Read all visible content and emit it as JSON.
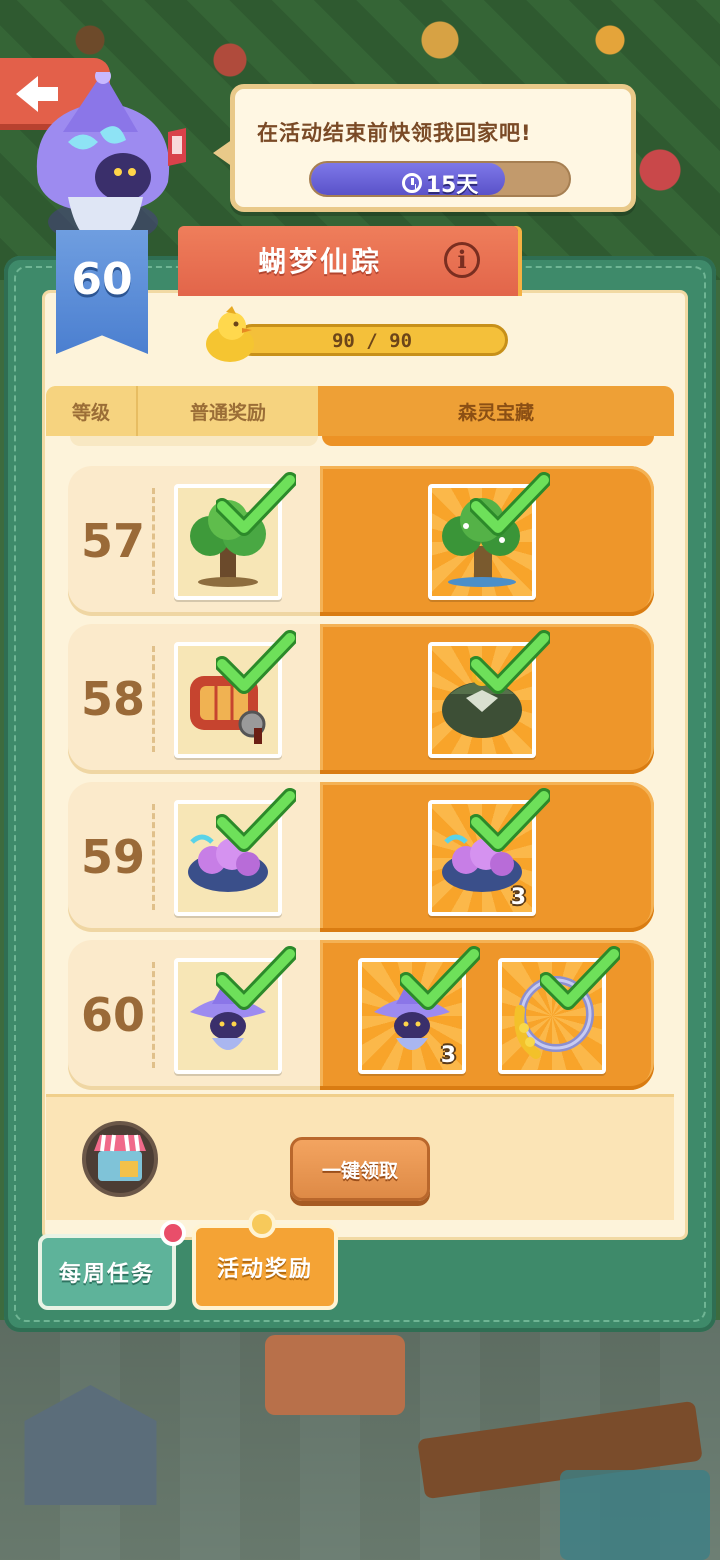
{
  "header": {
    "speech_text": "在活动结束前快领我回家吧!",
    "timer_label": "15天",
    "timer_progress": 0.75
  },
  "panel": {
    "title": "蝴梦仙踪",
    "level": "60",
    "xp_text": "90 / 90",
    "xp_progress": 1.0
  },
  "columns": {
    "level": "等级",
    "normal": "普通奖励",
    "premium": "森灵宝藏"
  },
  "rows": [
    {
      "level": "57",
      "normal": {
        "item": "tree",
        "claimed": true
      },
      "premium": [
        {
          "item": "flowering-tree",
          "qty": "",
          "claimed": true
        }
      ]
    },
    {
      "level": "58",
      "normal": {
        "item": "red-machine",
        "claimed": true
      },
      "premium": [
        {
          "item": "green-pouch",
          "qty": "",
          "claimed": true
        }
      ]
    },
    {
      "level": "59",
      "normal": {
        "item": "purple-flower-bush",
        "claimed": true
      },
      "premium": [
        {
          "item": "purple-flower-bush",
          "qty": "3",
          "claimed": true
        }
      ]
    },
    {
      "level": "60",
      "normal": {
        "item": "witch-cat",
        "claimed": true
      },
      "premium": [
        {
          "item": "witch-cat",
          "qty": "3",
          "claimed": true
        },
        {
          "item": "golden-ring-frame",
          "qty": "",
          "claimed": true
        }
      ]
    }
  ],
  "footer": {
    "claim_all_label": "一键领取"
  },
  "tabs": {
    "weekly": "每周任务",
    "event": "活动奖励"
  },
  "colors": {
    "panel_green": "#3e8a6a",
    "premium_orange": "#ee962a",
    "check_green": "#4cc94a",
    "timer_purple": "#6a62d8"
  }
}
